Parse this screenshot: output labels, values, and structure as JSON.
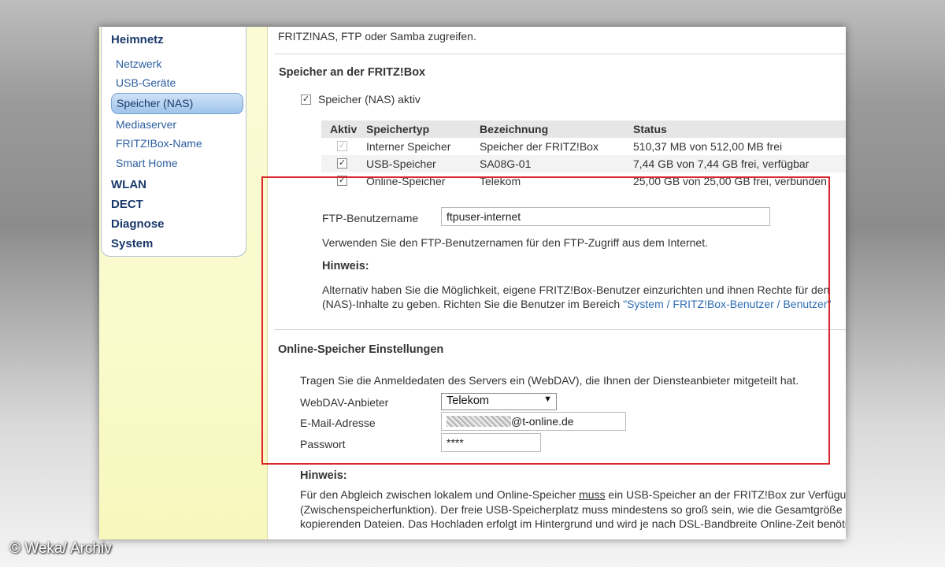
{
  "sidebar": {
    "group_heimnetz": "Heimnetz",
    "items": [
      {
        "label": "Netzwerk"
      },
      {
        "label": "USB-Geräte"
      },
      {
        "label": "Speicher (NAS)"
      },
      {
        "label": "Mediaserver"
      },
      {
        "label": "FRITZ!Box-Name"
      },
      {
        "label": "Smart Home"
      }
    ],
    "groups": [
      "WLAN",
      "DECT",
      "Diagnose",
      "System"
    ]
  },
  "content": {
    "intro_tail": "FRITZ!NAS, FTP oder Samba zugreifen.",
    "storage_section_title": "Speicher an der FRITZ!Box",
    "nas_active_label": "Speicher (NAS) aktiv",
    "table": {
      "headers": [
        "Aktiv",
        "Speichertyp",
        "Bezeichnung",
        "Status"
      ],
      "rows": [
        {
          "type": "Interner Speicher",
          "name": "Speicher der FRITZ!Box",
          "status": "510,37 MB von 512,00 MB frei"
        },
        {
          "type": "USB-Speicher",
          "name": "SA08G-01",
          "status": "7,44 GB von 7,44 GB frei, verfügbar"
        },
        {
          "type": "Online-Speicher",
          "name": "Telekom",
          "status": "25,00 GB von 25,00 GB frei, verbunden"
        }
      ]
    },
    "ftp_user_label": "FTP-Benutzername",
    "ftp_user_value": "ftpuser-internet",
    "ftp_user_help": "Verwenden Sie den FTP-Benutzernamen für den FTP-Zugriff aus dem Internet.",
    "hint1_title": "Hinweis:",
    "hint1_line1": "Alternativ haben Sie die Möglichkeit, eigene FRITZ!Box-Benutzer einzurichten und ihnen Rechte für den",
    "hint1_line2_pre": "(NAS)-Inhalte zu geben. Richten Sie die Benutzer im Bereich ",
    "hint1_line2_link": "\"System / FRITZ!Box-Benutzer / Benutzer\"",
    "online_section_title": "Online-Speicher Einstellungen",
    "online_intro": "Tragen Sie die Anmeldedaten des Servers ein (WebDAV), die Ihnen der Diensteanbieter mitgeteilt hat.",
    "webdav_label": "WebDAV-Anbieter",
    "webdav_value": "Telekom",
    "email_label": "E-Mail-Adresse",
    "email_suffix": "@t-online.de",
    "password_label": "Passwort",
    "password_value": "****",
    "hint2_title": "Hinweis:",
    "hint2_line1_pre": "Für den Abgleich zwischen lokalem und Online-Speicher ",
    "hint2_line1_u": "muss",
    "hint2_line1_post": " ein USB-Speicher an der FRITZ!Box zur Verfügung stehen",
    "hint2_line2": "(Zwischenspeicherfunktion). Der freie USB-Speicherplatz muss mindestens so groß sein, wie die Gesamtgröße der zu",
    "hint2_line3": "kopierenden Dateien. Das Hochladen erfolgt im Hintergrund und wird je nach DSL-Bandbreite Online-Zeit benötigen."
  },
  "watermark": "© Weka/ Archiv",
  "colors": {
    "highlight_box": "#d9262b",
    "link": "#2d6db5",
    "nav_heading": "#1b3a6b"
  }
}
